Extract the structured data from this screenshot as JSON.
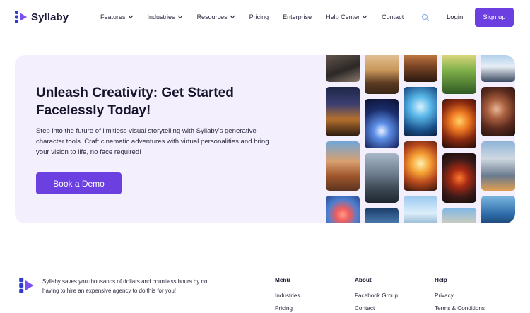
{
  "brand": {
    "name": "Syllaby",
    "accent": "#6b3fe0",
    "logo_blue": "#2f3ccc",
    "logo_purple": "#7b4ff0"
  },
  "nav": {
    "items": [
      {
        "label": "Features",
        "dropdown": true
      },
      {
        "label": "Industries",
        "dropdown": true
      },
      {
        "label": "Resources",
        "dropdown": true
      },
      {
        "label": "Pricing",
        "dropdown": false
      },
      {
        "label": "Enterprise",
        "dropdown": false
      },
      {
        "label": "Help Center",
        "dropdown": true
      },
      {
        "label": "Contact",
        "dropdown": false
      }
    ],
    "search_icon": "search-icon",
    "login_label": "Login",
    "signup_label": "Sign up"
  },
  "hero": {
    "title": "Unleash Creativity: Get Started Facelessly Today!",
    "description": "Step into the future of limitless visual storytelling with Syllaby’s generative character tools. Craft cinematic adventures with virtual personalities and bring your vision to life, no face required!",
    "cta_label": "Book a Demo",
    "background": "#f3effd"
  },
  "footer": {
    "tagline": "Syllaby saves you thousands of dollars and countless hours by not having to hire an expensive agency to do this for you!",
    "columns": [
      {
        "heading": "Menu",
        "links": [
          "Industries",
          "Pricing"
        ]
      },
      {
        "heading": "About",
        "links": [
          "Facebook Group",
          "Contact"
        ]
      },
      {
        "heading": "Help",
        "links": [
          "Privacy",
          "Terms & Conditions"
        ]
      }
    ]
  }
}
